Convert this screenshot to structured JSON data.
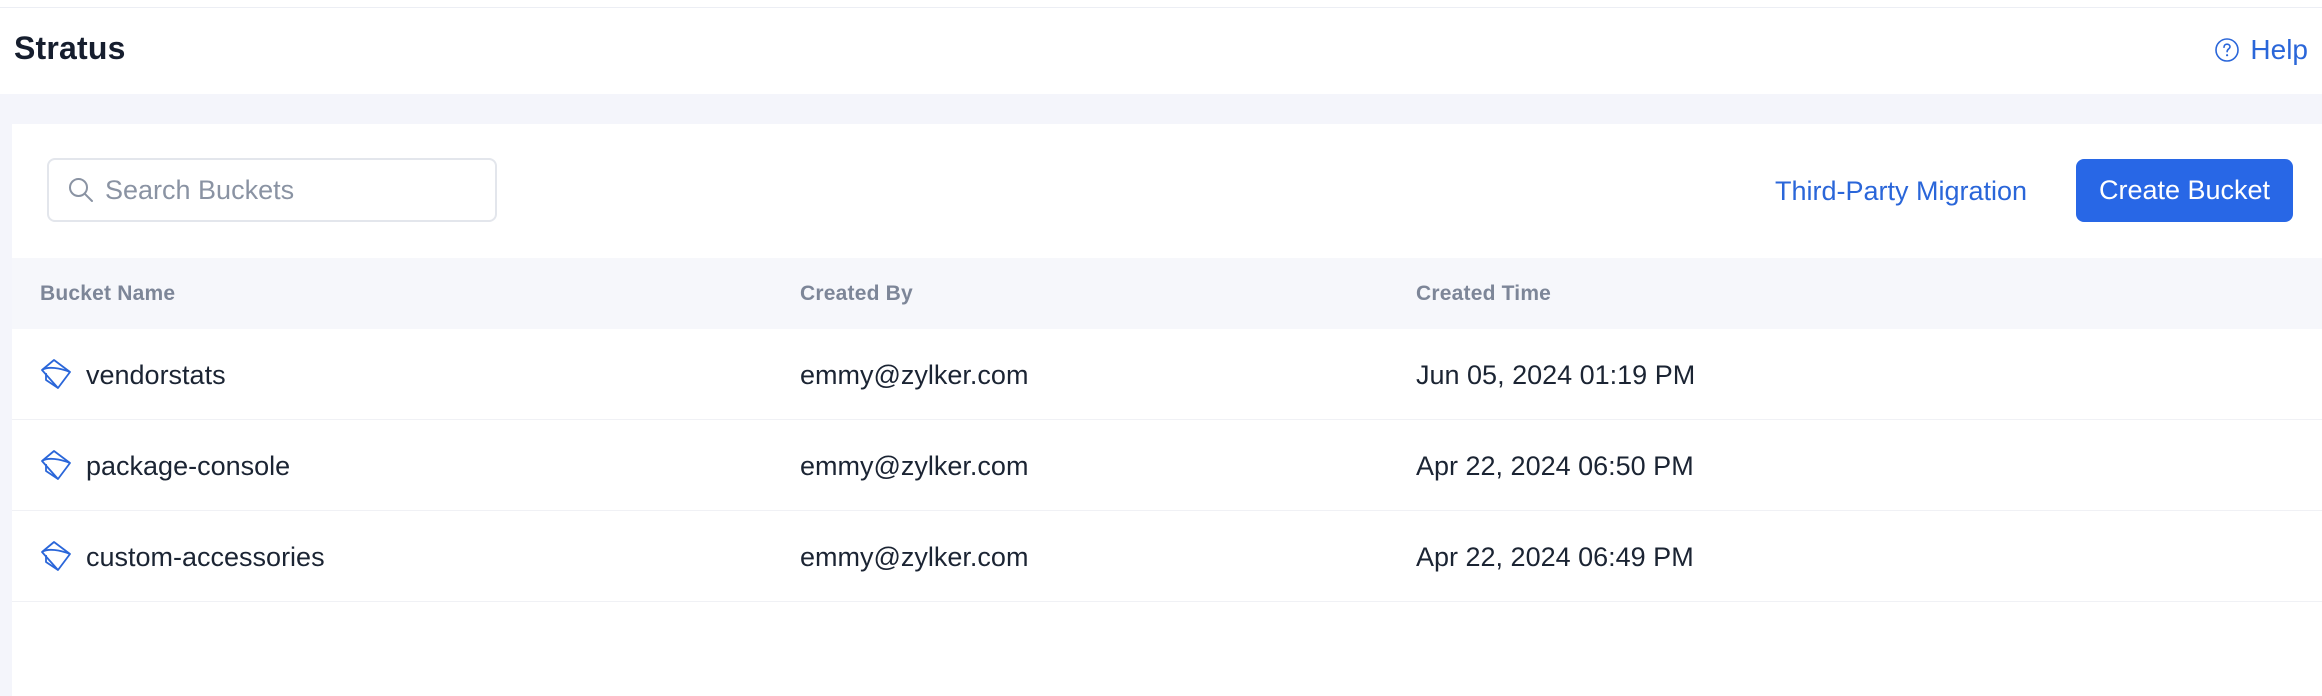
{
  "header": {
    "title": "Stratus",
    "help_label": "Help",
    "help_icon": "question-circle-icon"
  },
  "toolbar": {
    "search_placeholder": "Search Buckets",
    "search_value": "",
    "migration_label": "Third-Party Migration",
    "create_label": "Create Bucket"
  },
  "table": {
    "columns": [
      "Bucket Name",
      "Created By",
      "Created Time"
    ],
    "rows": [
      {
        "name": "vendorstats",
        "created_by": "emmy@zylker.com",
        "created_time": "Jun 05, 2024 01:19 PM",
        "icon": "bucket-icon"
      },
      {
        "name": "package-console",
        "created_by": "emmy@zylker.com",
        "created_time": "Apr 22, 2024 06:50 PM",
        "icon": "bucket-icon"
      },
      {
        "name": "custom-accessories",
        "created_by": "emmy@zylker.com",
        "created_time": "Apr 22, 2024 06:49 PM",
        "icon": "bucket-icon"
      }
    ]
  },
  "colors": {
    "accent": "#2867e6",
    "link": "#2a66d9",
    "background": "#f4f5fb"
  }
}
